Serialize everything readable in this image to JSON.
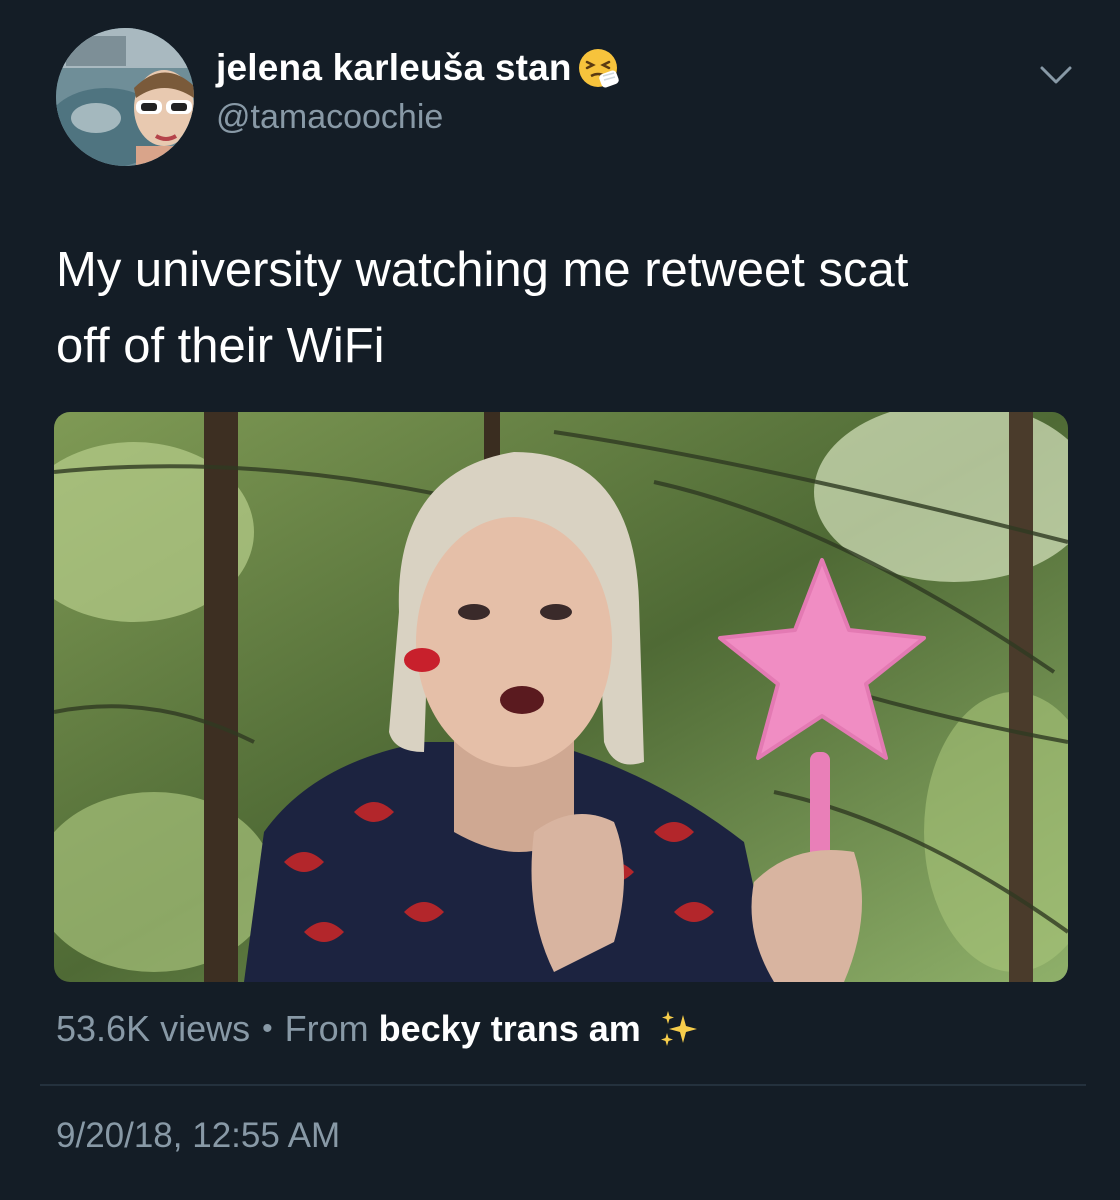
{
  "tweet": {
    "display_name": "jelena karleuša stan",
    "name_emoji": "sneezing-face-emoji",
    "handle": "@tamacoochie",
    "text": "My university watching me retweet scat\noff of their WiFi",
    "views": "53.6K views",
    "separator": "•",
    "from_label": "From",
    "source_account": "becky trans am",
    "source_emoji": "sparkles-emoji",
    "timestamp": "9/20/18, 12:55 AM"
  },
  "colors": {
    "background": "#141d26",
    "secondary_text": "#8899a6",
    "divider": "#24313d"
  }
}
